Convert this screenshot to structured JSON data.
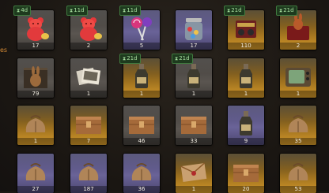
{
  "edge_text": "es",
  "rows": [
    [
      {
        "name": "gummy-bear-red-stack",
        "rarity": "gray",
        "count": "17",
        "timer": "4d",
        "icon": "gummy-bear-icon"
      },
      {
        "name": "gummy-bear-red",
        "rarity": "gray",
        "count": "2",
        "timer": "11d",
        "icon": "gummy-bear-icon"
      },
      {
        "name": "lollipops",
        "rarity": "purple",
        "count": "5",
        "timer": "11d",
        "icon": "lollipop-icon"
      },
      {
        "name": "candy-jar",
        "rarity": "purple",
        "count": "17",
        "timer": "",
        "icon": "jar-icon"
      },
      {
        "name": "film-reel-box",
        "rarity": "gold",
        "count": "110",
        "timer": "21d",
        "icon": "film-box-icon"
      },
      {
        "name": "chocolate-bunny-box",
        "rarity": "gold",
        "count": "2",
        "timer": "21d",
        "icon": "bunny-box-icon"
      }
    ],
    [
      {
        "name": "bunny-crate",
        "rarity": "gray",
        "count": "79",
        "timer": "",
        "icon": "bunny-crate-icon"
      },
      {
        "name": "photo-stack",
        "rarity": "gray",
        "count": "1",
        "timer": "",
        "icon": "photos-icon"
      },
      {
        "name": "milk-bottle-photos",
        "rarity": "gold",
        "count": "1",
        "timer": "21d",
        "icon": "bottle-icon"
      },
      {
        "name": "milk-bottle-photos-2",
        "rarity": "gray",
        "count": "1",
        "timer": "21d",
        "icon": "bottle-icon"
      },
      {
        "name": "brown-bottle",
        "rarity": "gold",
        "count": "1",
        "timer": "",
        "icon": "bottle-icon"
      },
      {
        "name": "retro-tv",
        "rarity": "gold",
        "count": "1",
        "timer": "",
        "icon": "tv-icon"
      }
    ],
    [
      {
        "name": "golden-sack",
        "rarity": "gold",
        "count": "1",
        "timer": "",
        "icon": "sack-icon"
      },
      {
        "name": "dark-crate",
        "rarity": "gold",
        "count": "7",
        "timer": "",
        "icon": "crate-icon"
      },
      {
        "name": "wooden-crate-1",
        "rarity": "gray",
        "count": "46",
        "timer": "",
        "icon": "crate-icon"
      },
      {
        "name": "wooden-crate-2",
        "rarity": "gray",
        "count": "33",
        "timer": "",
        "icon": "crate-icon"
      },
      {
        "name": "dark-bottle",
        "rarity": "purple",
        "count": "9",
        "timer": "",
        "icon": "bottle-icon"
      },
      {
        "name": "burlap-sack-1",
        "rarity": "gold",
        "count": "35",
        "timer": "",
        "icon": "sack-icon"
      }
    ],
    [
      {
        "name": "burlap-sack-2",
        "rarity": "purple",
        "count": "27",
        "timer": "",
        "icon": "sack-icon"
      },
      {
        "name": "burlap-sack-3",
        "rarity": "purple",
        "count": "187",
        "timer": "",
        "icon": "sack-icon"
      },
      {
        "name": "burlap-sack-4",
        "rarity": "purple",
        "count": "36",
        "timer": "",
        "icon": "sack-icon"
      },
      {
        "name": "envelope-bundle",
        "rarity": "gold",
        "count": "1",
        "timer": "",
        "icon": "envelope-icon"
      },
      {
        "name": "wooden-crate-3",
        "rarity": "gold",
        "count": "20",
        "timer": "",
        "icon": "crate-icon"
      },
      {
        "name": "burlap-sack-5",
        "rarity": "gold",
        "count": "53",
        "timer": "",
        "icon": "sack-icon"
      }
    ]
  ]
}
